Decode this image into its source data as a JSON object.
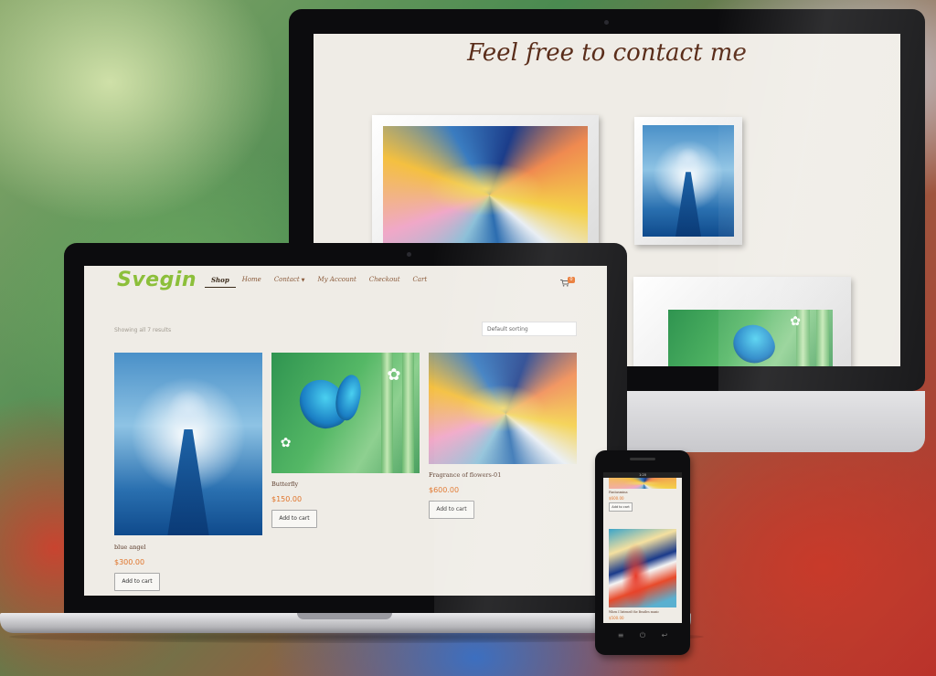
{
  "desktop": {
    "page_title": "Feel free to contact me"
  },
  "laptop": {
    "logo": "Svegin",
    "nav": {
      "shop": "Shop",
      "home": "Home",
      "contact": "Contact",
      "my_account": "My Account",
      "checkout": "Checkout",
      "cart": "Cart"
    },
    "cart_count": "0",
    "result_count": "Showing all 7 results",
    "sort": {
      "selected": "Default sorting"
    },
    "products": [
      {
        "name": "blue angel",
        "price": "$300.00",
        "button": "Add to cart"
      },
      {
        "name": "Butterfly",
        "price": "$150.00",
        "button": "Add to cart"
      },
      {
        "name": "Fragrance of flowers-01",
        "price": "$600.00",
        "button": "Add to cart"
      }
    ]
  },
  "phone": {
    "status_time": "1:20",
    "items": [
      {
        "name": "Fantasmina",
        "price": "$600.00",
        "button": "Add to cart"
      },
      {
        "name": "When I listened the Beatles music",
        "price": "$500.00"
      }
    ]
  },
  "colors": {
    "accent_price": "#e0742a",
    "logo_green": "#8cbf3a",
    "title_brown": "#5a2d1a"
  }
}
